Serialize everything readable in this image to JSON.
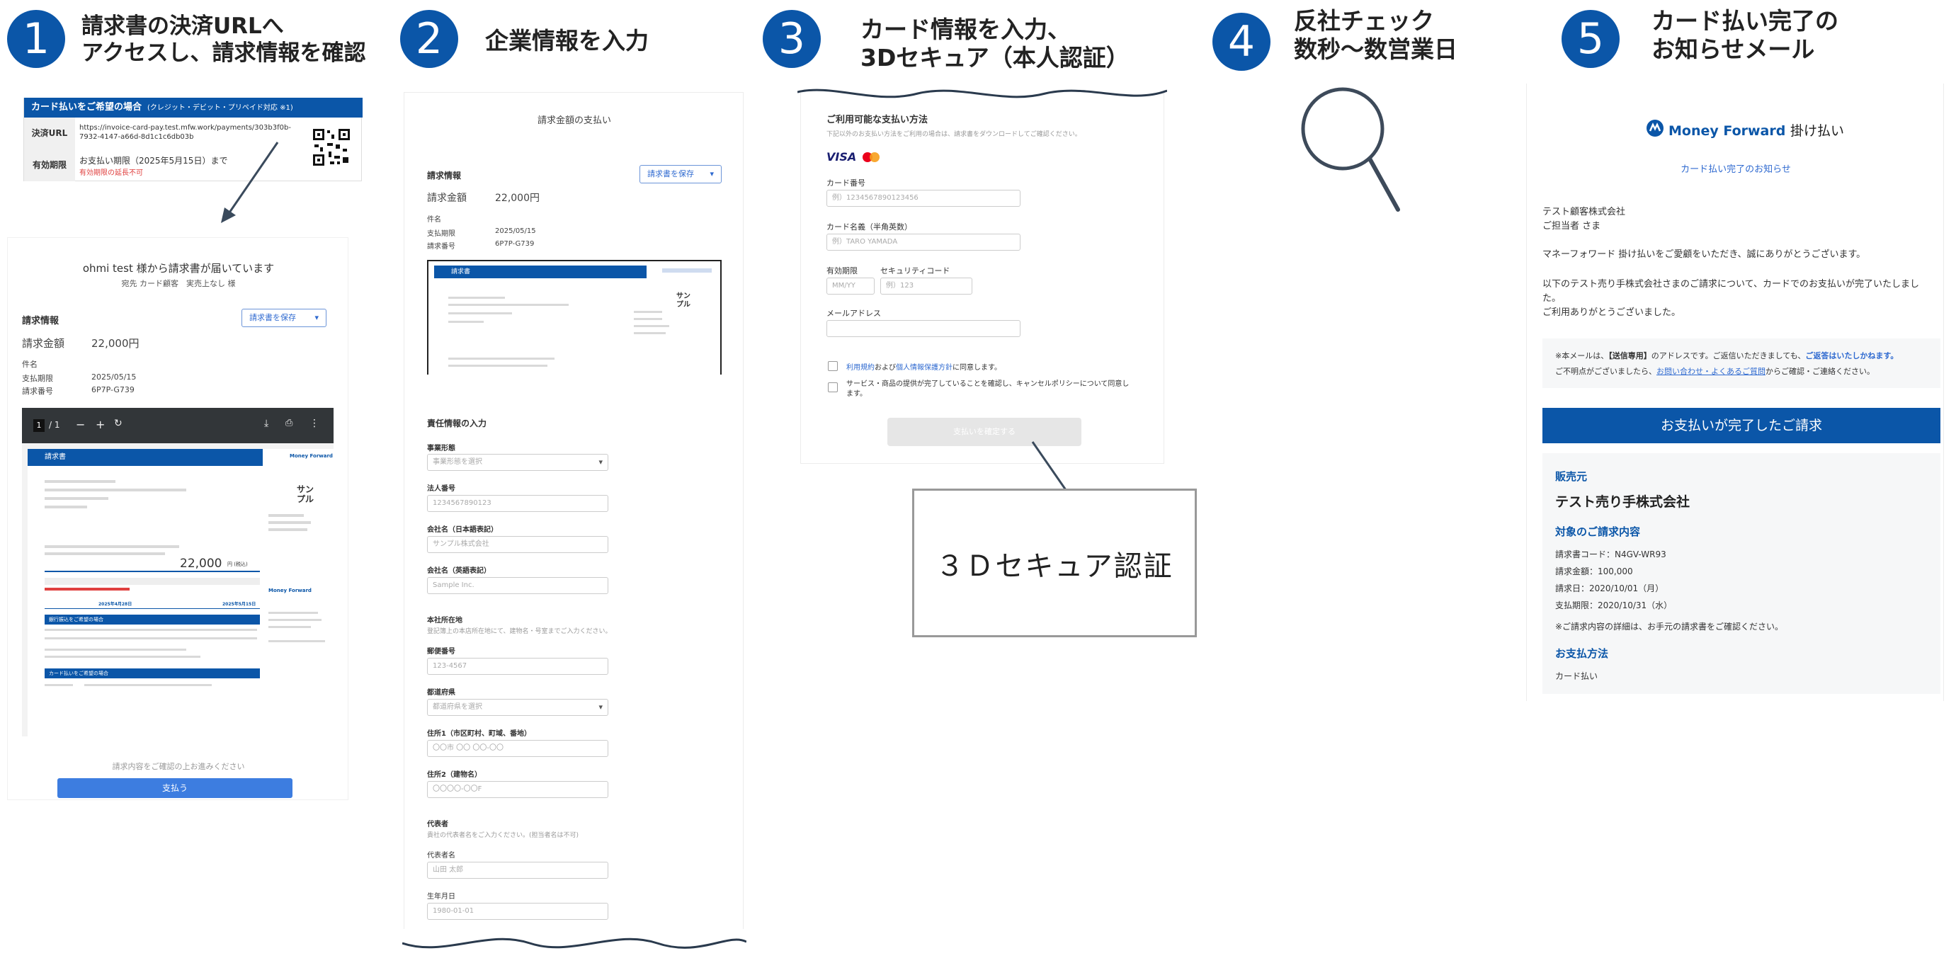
{
  "steps": [
    {
      "num": "1",
      "title": "請求書の決済URLへ\nアクセスし、請求情報を確認"
    },
    {
      "num": "2",
      "title": "企業情報を入力"
    },
    {
      "num": "3",
      "title": "カード情報を入力、\n3Dセキュア（本人認証）"
    },
    {
      "num": "4",
      "title": "反社チェック\n数秒〜数営業日"
    },
    {
      "num": "5",
      "title": "カード払い完了の\nお知らせメール"
    }
  ],
  "step1": {
    "banner": "カード払いをご希望の場合",
    "banner_note": "(クレジット・デビット・プリペイド対応 ※1)",
    "url_label": "決済URL",
    "url_value": "https://invoice-card-pay.test.mfw.work/payments/303b3f0b-7932-4147-a66d-8d1c1c6db03b",
    "expiry_label": "有効期限",
    "expiry_value": "お支払い期限（2025年5月15日）まで",
    "expiry_note": "有効期限の延長不可",
    "invoice_heading": "ohmi test 様から請求書が届いています",
    "invoice_sub": "宛先 カード顧客　実売上なし 様",
    "section": "請求情報",
    "save_button": "請求書を保存",
    "amount_label": "請求金額",
    "amount_value": "22,000円",
    "subject_label": "件名",
    "due_label": "支払期限",
    "due_value": "2025/05/15",
    "number_label": "請求番号",
    "number_value": "6P7P-G739",
    "page_indicator": "1",
    "page_total": "/ 1",
    "doc_title": "請求書",
    "doc_sample": "サン\nプル",
    "doc_amount": "22,000",
    "doc_amount_unit": "円 (税込)",
    "doc_brand": "Money Forward",
    "doc_bank_title": "銀行振込をご希望の場合",
    "doc_card_title": "カード払いをご希望の場合",
    "doc_billing_date": "2025年4月28日",
    "doc_due_date": "2025年5月15日",
    "confirm_note": "請求内容をご確認の上お進みください",
    "pay_button": "支払う"
  },
  "step2": {
    "heading": "請求金額の支払い",
    "section": "請求情報",
    "save_button": "請求書を保存",
    "amount_label": "請求金額",
    "amount_value": "22,000円",
    "subject_label": "件名",
    "due_label": "支払期限",
    "due_value": "2025/05/15",
    "number_label": "請求番号",
    "number_value": "6P7P-G739",
    "doc_title": "請求書",
    "doc_sample": "サン\nプル",
    "form_title": "責任情報の入力",
    "fields": [
      {
        "label": "事業形態",
        "placeholder": "事業形態を選択",
        "select": true
      },
      {
        "label": "法人番号",
        "placeholder": "1234567890123",
        "select": false
      },
      {
        "label": "会社名（日本語表記）",
        "placeholder": "サンプル株式会社",
        "select": false
      },
      {
        "label": "会社名（英語表記）",
        "placeholder": "Sample Inc.",
        "select": false
      }
    ],
    "address_title": "本社所在地",
    "address_note": "登記簿上の本店所在地にて、建物名・号室までご入力ください。",
    "address_fields": [
      {
        "label": "郵便番号",
        "placeholder": "123-4567",
        "select": false
      },
      {
        "label": "都道府県",
        "placeholder": "都道府県を選択",
        "select": true
      },
      {
        "label": "住所1（市区町村、町域、番地）",
        "placeholder": "〇〇市 〇〇 〇〇-〇〇",
        "select": false
      },
      {
        "label": "住所2（建物名）",
        "placeholder": "〇〇〇〇-〇〇F",
        "select": false
      }
    ],
    "rep_title": "代表者",
    "rep_note": "貴社の代表者名をご入力ください。(担当者名は不可)",
    "rep_fields": [
      {
        "label": "代表者名",
        "placeholder": "山田 太郎",
        "select": false
      },
      {
        "label": "生年月日",
        "placeholder": "1980-01-01",
        "select": false
      }
    ]
  },
  "step3": {
    "heading": "ご利用可能な支払い方法",
    "note": "下記以外のお支払い方法をご利用の場合は、請求書をダウンロードしてご確認ください。",
    "visa": "VISA",
    "card_number_label": "カード番号",
    "card_number_placeholder": "例）1234567890123456",
    "card_name_label": "カード名義（半角英数）",
    "card_name_placeholder": "例）TARO YAMADA",
    "expiry_label": "有効期限",
    "expiry_placeholder": "MM/YY",
    "cvc_label": "セキュリティコード",
    "cvc_placeholder": "例）123",
    "email_label": "メールアドレス",
    "terms_link1": "利用規約",
    "terms_and": "および",
    "terms_link2": "個人情報保護方針",
    "terms_suffix": "に同意します。",
    "service_check": "サービス・商品の提供が完了していることを確認し、キャンセルポリシーについて同意します。",
    "confirm_button": "支払いを確定する",
    "secure_box": "３Ｄセキュア認証"
  },
  "step5": {
    "logo_text": "Money Forward",
    "logo_suffix": "掛け払い",
    "subtitle": "カード払い完了のお知らせ",
    "recipient_company": "テスト顧客株式会社",
    "recipient_person": "ご担当者 さま",
    "greeting": "マネーフォワード 掛け払いをご愛顧をいただき、誠にありがとうございます。",
    "body1": "以下のテスト売り手株式会社さまのご請求について、カードでのお支払いが完了いたしまし",
    "body2": "た。",
    "body3": "ご利用ありがとうございました。",
    "notice1_a": "※本メールは、",
    "notice1_b": "【送信専用】",
    "notice1_c": "のアドレスです。ご返信いただきましても、",
    "notice1_d": "ご返答はいたしかねます。",
    "notice2_a": "ご不明点がございましたら、",
    "notice2_link": "お問い合わせ・よくあるご質問",
    "notice2_b": "からご確認・ご連絡ください。",
    "banner": "お支払いが完了したご請求",
    "seller_label": "販売元",
    "seller_name": "テスト売り手株式会社",
    "invoice_section": "対象のご請求内容",
    "invoice_lines": [
      "請求書コード：N4GV-WR93",
      "請求金額：100,000",
      "請求日：2020/10/01（月）",
      "支払期限：2020/10/31（水）"
    ],
    "invoice_note": "※ご請求内容の詳細は、お手元の請求書をご確認ください。",
    "payment_section": "お支払方法",
    "payment_value": "カード払い"
  },
  "colors": {
    "brand_blue": "#0b56a8",
    "link_blue": "#2f6ad0",
    "pay_button": "#3d7de0",
    "alert_red": "#e0403f"
  }
}
